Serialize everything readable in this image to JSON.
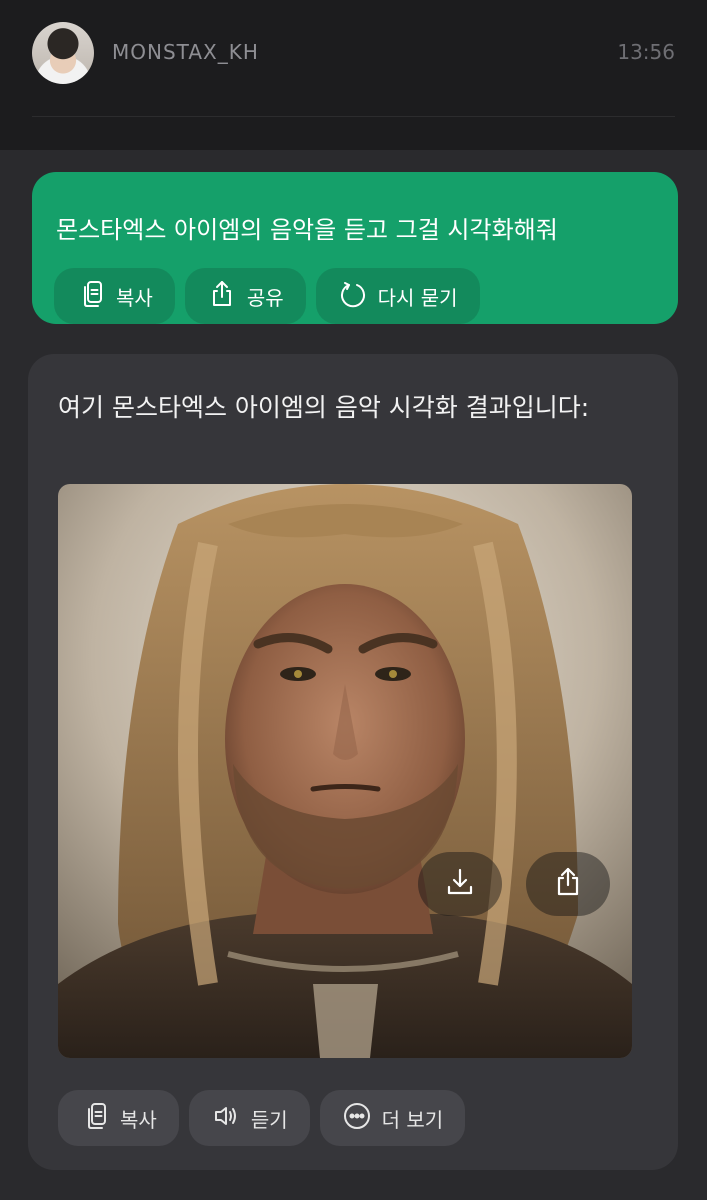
{
  "header": {
    "username": "MONSTAX_KH",
    "time": "13:56"
  },
  "prompt": {
    "text": "몬스타엑스 아이엠의 음악을 듣고 그걸 시각화해줘",
    "actions": [
      {
        "label": "복사",
        "icon": "copy-icon"
      },
      {
        "label": "공유",
        "icon": "share-icon"
      },
      {
        "label": "다시 묻기",
        "icon": "refresh-icon"
      }
    ]
  },
  "answer": {
    "text": "여기 몬스타엑스 아이엠의 음악 시각화 결과입니다:",
    "image_buttons": [
      {
        "icon": "download-icon"
      },
      {
        "icon": "share-icon"
      }
    ],
    "actions": [
      {
        "label": "복사",
        "icon": "copy-icon"
      },
      {
        "label": "듣기",
        "icon": "speaker-icon"
      },
      {
        "label": "더 보기",
        "icon": "more-icon"
      }
    ]
  },
  "colors": {
    "accent_green": "#15a06a",
    "background": "#1c1c1e",
    "card": "#36363a"
  }
}
